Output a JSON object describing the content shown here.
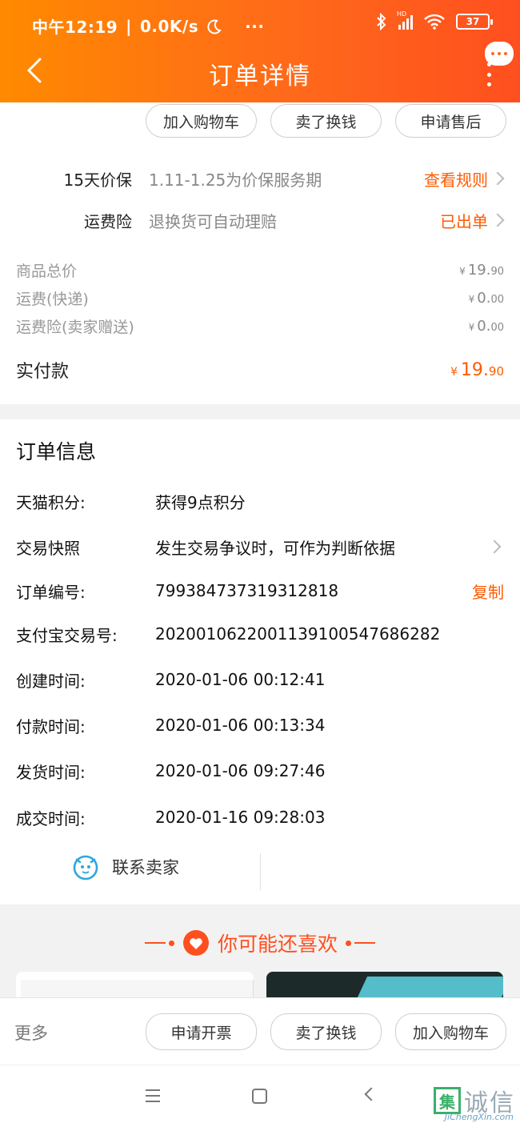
{
  "status_bar": {
    "time": "中午12:19",
    "speed": "0.0K/s",
    "network": "HD",
    "battery": "37",
    "overflow": "···"
  },
  "header": {
    "title": "订单详情"
  },
  "actions_top": {
    "add_cart": "加入购物车",
    "sell": "卖了换钱",
    "after_sale": "申请售后"
  },
  "services": [
    {
      "label": "15天价保",
      "value": "1.11-1.25为价保服务期",
      "action": "查看规则"
    },
    {
      "label": "运费险",
      "value": "退换货可自动理赔",
      "action": "已出单"
    }
  ],
  "prices": [
    {
      "label": "商品总价",
      "symbol": "¥",
      "int": "19.",
      "dec": "90"
    },
    {
      "label": "运费(快递)",
      "symbol": "¥",
      "int": "0.",
      "dec": "00"
    },
    {
      "label": "运费险(卖家赠送)",
      "symbol": "¥",
      "int": "0.",
      "dec": "00"
    }
  ],
  "total": {
    "label": "实付款",
    "symbol": "¥",
    "int": "19.",
    "dec": "90"
  },
  "order_info": {
    "title": "订单信息",
    "rows": [
      {
        "key": "天猫积分:",
        "value": "获得9点积分"
      },
      {
        "key": "交易快照",
        "value": "发生交易争议时，可作为判断依据"
      },
      {
        "key": "订单编号:",
        "value": "799384737319312818",
        "action": "复制"
      },
      {
        "key": "支付宝交易号:",
        "value": "2020010622001139100547686282"
      },
      {
        "key": "创建时间:",
        "value": "2020-01-06 00:12:41"
      },
      {
        "key": "付款时间:",
        "value": "2020-01-06 00:13:34"
      },
      {
        "key": "发货时间:",
        "value": "2020-01-06 09:27:46"
      },
      {
        "key": "成交时间:",
        "value": "2020-01-16 09:28:03"
      }
    ],
    "contact": "联系卖家"
  },
  "recommend": {
    "title": "你可能还喜欢"
  },
  "bottom_bar": {
    "more": "更多",
    "invoice": "申请开票",
    "sell": "卖了换钱",
    "add_cart": "加入购物车"
  },
  "watermark": {
    "char": "集",
    "text": "诚信",
    "sub": "JiChengXin.com"
  },
  "colors": {
    "accent": "#ff5a00",
    "header_start": "#ff8a00",
    "header_end": "#ff4f1f"
  }
}
